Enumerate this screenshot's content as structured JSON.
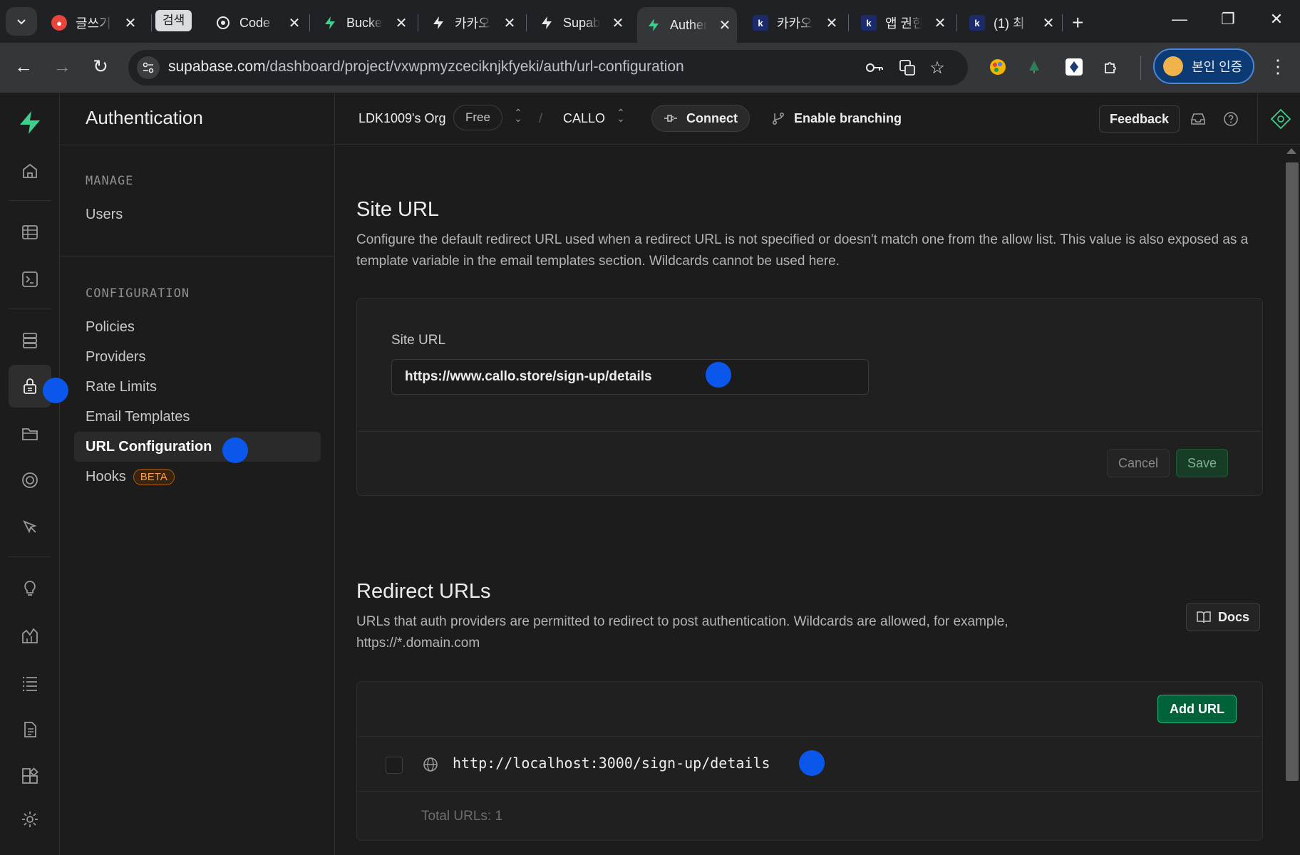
{
  "browser": {
    "tabs": [
      {
        "title": "글쓰기",
        "favicon_color": "#e8453c"
      },
      {
        "title": "Code",
        "favicon_color": "#ffffff"
      },
      {
        "title": "Bucket",
        "favicon_color": "#3ecf8e"
      },
      {
        "title": "카카오",
        "favicon_color": "#ffffff"
      },
      {
        "title": "Supabase",
        "favicon_color": "#ffffff"
      },
      {
        "title": "Authentication",
        "favicon_color": "#3ecf8e",
        "active": true
      },
      {
        "title": "카카오",
        "favicon_color": "#1a2a6c"
      },
      {
        "title": "앱 권한",
        "favicon_color": "#1a2a6c"
      },
      {
        "title": "(1) 최",
        "favicon_color": "#1a2a6c"
      }
    ],
    "search_chip": "검색",
    "url_host": "supabase.com",
    "url_path": "/dashboard/project/vxwpmyzceciknjkfyeki/auth/url-configuration",
    "verify_label": "본인 인증"
  },
  "sidebar": {
    "title": "Authentication",
    "manage_heading": "MANAGE",
    "manage_items": [
      {
        "label": "Users"
      }
    ],
    "config_heading": "CONFIGURATION",
    "config_items": [
      {
        "label": "Policies"
      },
      {
        "label": "Providers"
      },
      {
        "label": "Rate Limits"
      },
      {
        "label": "Email Templates"
      },
      {
        "label": "URL Configuration",
        "active": true
      },
      {
        "label": "Hooks",
        "badge": "BETA"
      }
    ]
  },
  "header": {
    "org": "LDK1009's Org",
    "plan": "Free",
    "separator": "/",
    "project": "CALLO",
    "connect": "Connect",
    "branching": "Enable branching",
    "feedback": "Feedback"
  },
  "site_url": {
    "title": "Site URL",
    "description": "Configure the default redirect URL used when a redirect URL is not specified or doesn't match one from the allow list. This value is also exposed as a template variable in the email templates section. Wildcards cannot be used here.",
    "field_label": "Site URL",
    "value": "https://www.callo.store/sign-up/details",
    "cancel": "Cancel",
    "save": "Save"
  },
  "redirect_urls": {
    "title": "Redirect URLs",
    "description": "URLs that auth providers are permitted to redirect to post authentication. Wildcards are allowed, for example, https://*.domain.com",
    "docs": "Docs",
    "add_url": "Add URL",
    "urls": [
      "http://localhost:3000/sign-up/details"
    ],
    "total": "Total URLs: 1"
  },
  "colors": {
    "brand": "#3ecf8e",
    "background": "#1c1c1c",
    "accent_button": "#006239",
    "marker_dot": "#0b57ec"
  }
}
